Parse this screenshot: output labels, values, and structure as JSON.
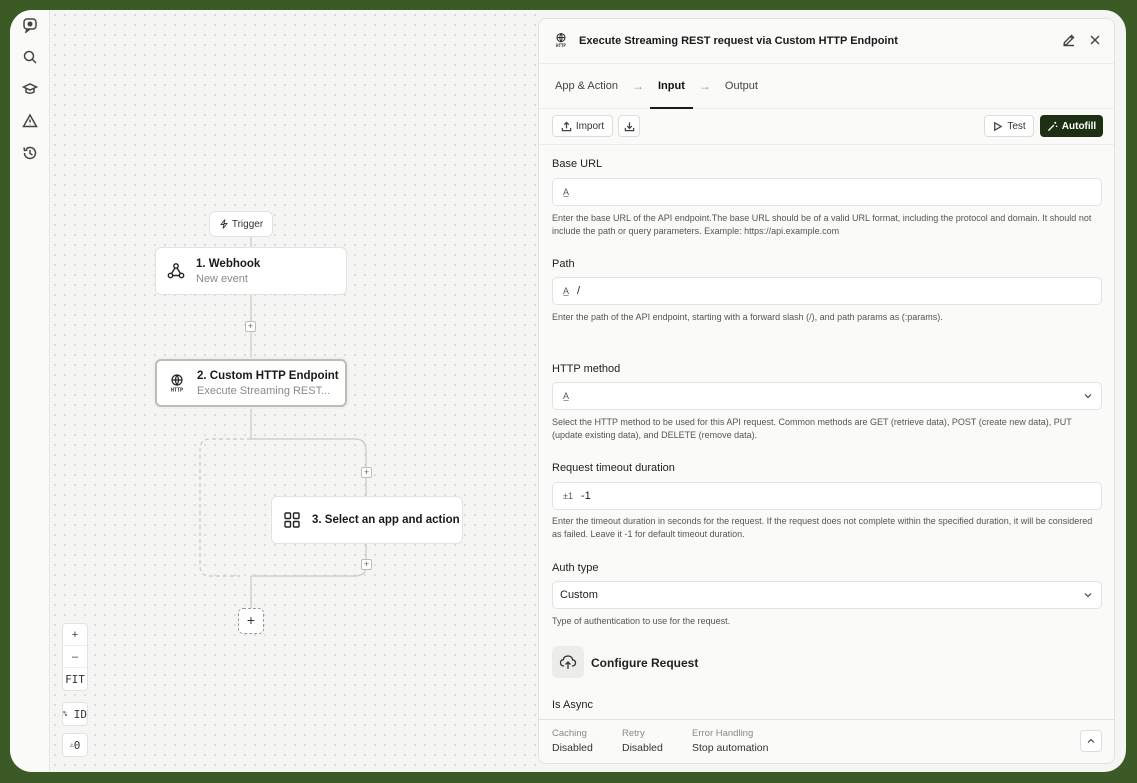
{
  "canvas": {
    "trigger_label": "Trigger",
    "nodes": [
      {
        "title": "1. Webhook",
        "subtitle": "New event"
      },
      {
        "title": "2. Custom HTTP Endpoint",
        "subtitle": "Execute Streaming REST..."
      },
      {
        "title": "3. Select an app and action"
      }
    ],
    "zoom": {
      "in": "+",
      "out": "–",
      "fit": "FIT"
    },
    "badges": {
      "ids": "ID",
      "warnings": "0"
    }
  },
  "panel": {
    "title": "Execute Streaming REST request via Custom HTTP Endpoint",
    "tabs": [
      {
        "label": "App & Action"
      },
      {
        "label": "Input"
      },
      {
        "label": "Output"
      }
    ],
    "toolbar": {
      "import": "Import",
      "test": "Test",
      "autofill": "Autofill"
    },
    "fields": {
      "base_url": {
        "label": "Base URL",
        "value": "",
        "help": "Enter the base URL of the API endpoint.The base URL should be of a valid URL format, including the protocol and domain. It should not include the path or query parameters. Example: https://api.example.com"
      },
      "path": {
        "label": "Path",
        "value": "/",
        "help": "Enter the path of the API endpoint, starting with a forward slash (/), and path params as (:params)."
      },
      "http_method": {
        "label": "HTTP method",
        "value": "",
        "help": "Select the HTTP method to be used for this API request. Common methods are GET (retrieve data), POST (create new data), PUT (update existing data), and DELETE (remove data)."
      },
      "timeout": {
        "label": "Request timeout duration",
        "prefix": "±1",
        "value": "-1",
        "help": "Enter the timeout duration in seconds for the request. If the request does not complete within the specified duration, it will be considered as failed. Leave it -1 for default timeout duration."
      },
      "auth_type": {
        "label": "Auth type",
        "value": "Custom",
        "help": "Type of authentication to use for the request."
      }
    },
    "section": {
      "title": "Configure Request"
    },
    "is_async_label": "Is Async",
    "footer": {
      "caching": {
        "label": "Caching",
        "value": "Disabled"
      },
      "retry": {
        "label": "Retry",
        "value": "Disabled"
      },
      "error": {
        "label": "Error Handling",
        "value": "Stop automation"
      }
    }
  }
}
